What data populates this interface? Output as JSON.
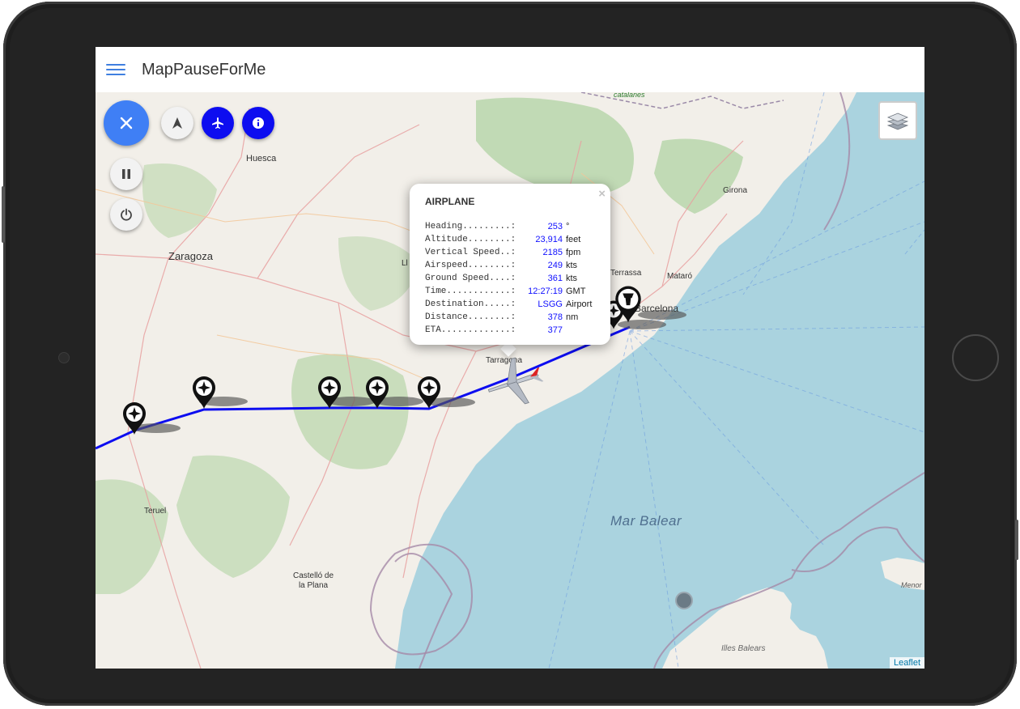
{
  "app": {
    "title": "MapPauseForMe"
  },
  "map_labels": {
    "zaragoza": "Zaragoza",
    "huesca": "Huesca",
    "teruel": "Teruel",
    "castello": "Castelló de\nla Plana",
    "tarragona": "Tarragona",
    "barcelona": "Barcelona",
    "mataro": "Mataró",
    "terrassa": "Terrassa",
    "girona": "Girona",
    "catalanes": "catalanes",
    "mar_balear": "Mar Balear",
    "illes_balears": "Illes Balears",
    "menorca": "Menor",
    "lleida": "Ll"
  },
  "popup": {
    "title": "AIRPLANE",
    "close": "×",
    "rows": [
      {
        "label": "Heading.........:",
        "value": "253",
        "unit": "°"
      },
      {
        "label": "Altitude........:",
        "value": "23,914",
        "unit": "feet"
      },
      {
        "label": "Vertical Speed..:",
        "value": "2185",
        "unit": "fpm"
      },
      {
        "label": "Airspeed........:",
        "value": "249",
        "unit": "kts"
      },
      {
        "label": "Ground Speed....:",
        "value": "361",
        "unit": "kts"
      },
      {
        "label": "Time............:",
        "value": "12:27:19",
        "unit": "GMT"
      },
      {
        "label": "Destination.....:",
        "value": "LSGG",
        "unit": "Airport"
      },
      {
        "label": "Distance........:",
        "value": "378",
        "unit": "nm"
      },
      {
        "label": "ETA.............:",
        "value": "377",
        "unit": ""
      }
    ]
  },
  "attribution": "Leaflet",
  "icons": {
    "menu": "hamburger-icon",
    "close": "close-icon",
    "navigate": "navigation-arrow-icon",
    "airplane": "airplane-icon",
    "info": "info-icon",
    "pause": "pause-icon",
    "power": "power-icon",
    "layers": "layers-icon",
    "waypoint": "waypoint-marker-icon",
    "tower": "control-tower-icon"
  },
  "colors": {
    "accent": "#3f7ff5",
    "route": "#0d0df0",
    "sea": "#aad3df",
    "land": "#f2efe9",
    "forest": "#add19e"
  }
}
